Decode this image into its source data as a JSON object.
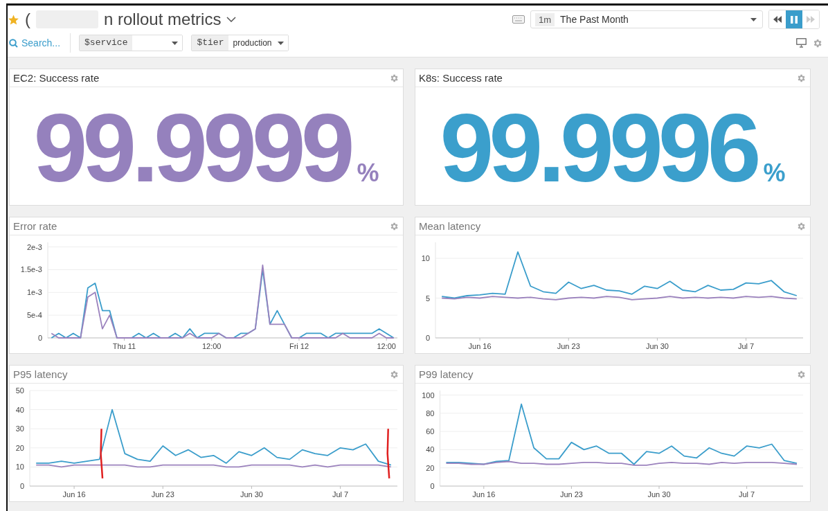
{
  "header": {
    "title_start": "(",
    "title_end": "n rollout metrics",
    "starred": true,
    "time": {
      "shortcut": "1m",
      "label": "The Past Month"
    },
    "playback": [
      {
        "kind": "rewind",
        "selected": false,
        "disabled": false
      },
      {
        "kind": "pause",
        "selected": true,
        "disabled": false
      },
      {
        "kind": "forward",
        "selected": false,
        "disabled": true
      }
    ],
    "search": {
      "label": "Search..."
    },
    "variables": [
      {
        "name": "$service"
      },
      {
        "name": "$tier",
        "value": "production"
      }
    ]
  },
  "widgets": [
    {
      "kind": "query_value",
      "title": "EC2: Success rate",
      "value": "99.9999",
      "unit": "%",
      "color": "#9581bd"
    },
    {
      "kind": "query_value",
      "title": "K8s: Success rate",
      "value": "99.9996",
      "unit": "%",
      "color": "#3b9fcc"
    },
    {
      "kind": "timeseries",
      "title": "Error rate",
      "chart_data": {
        "type": "line",
        "categories": [
          null,
          null,
          null,
          null,
          null,
          null,
          null,
          null,
          null,
          null,
          "Thu 11",
          null,
          null,
          null,
          null,
          null,
          null,
          null,
          null,
          null,
          null,
          null,
          "12:00",
          null,
          null,
          null,
          null,
          null,
          null,
          null,
          null,
          null,
          null,
          null,
          "Fri 12",
          null,
          null,
          null,
          null,
          null,
          null,
          null,
          null,
          null,
          null,
          null,
          "12:00",
          null
        ],
        "series": [
          {
            "color": "#3a9dcb",
            "values": [
              0,
              0.0001,
              0,
              0.0001,
              0,
              0.0011,
              0.0012,
              0.0006,
              0.0006,
              0,
              0,
              0,
              0.0001,
              0,
              0.0001,
              0,
              0,
              0.0001,
              0,
              0.0002,
              0,
              0.0001,
              0.0001,
              0.0001,
              0,
              0,
              0.0001,
              0.0001,
              0.0002,
              0.0015,
              0.0003,
              0.0006,
              0.0003,
              0,
              0,
              0.0001,
              0.0001,
              0.0001,
              0,
              0.0001,
              0.0001,
              0.0001,
              0.0001,
              0.0001,
              0.0001,
              0.0002,
              0.0001,
              0
            ]
          },
          {
            "color": "#9b82bd",
            "values": [
              0.0001,
              0,
              0,
              0,
              0,
              0.0009,
              0.001,
              0.0002,
              0.0005,
              0,
              0,
              0,
              0,
              0,
              0,
              0,
              0,
              0,
              0,
              0.0001,
              0,
              0,
              0,
              0.0001,
              0,
              0,
              0,
              0.0001,
              0.0002,
              0.0016,
              0.0003,
              0.0003,
              0.0003,
              0,
              0,
              0,
              0,
              0,
              0,
              0,
              0.0001,
              0,
              0,
              0,
              0,
              0.0001,
              0,
              0
            ]
          }
        ],
        "grid": true,
        "ylim": [
          0,
          0.0021
        ],
        "yticks": [
          {
            "value": 0,
            "label": "0"
          },
          {
            "value": 0.0005,
            "label": "5e-4"
          },
          {
            "value": 0.001,
            "label": "1e-3"
          },
          {
            "value": 0.0015,
            "label": "1.5e-3"
          },
          {
            "value": 0.002,
            "label": "2e-3"
          }
        ]
      }
    },
    {
      "kind": "timeseries",
      "title": "Mean latency",
      "chart_data": {
        "type": "line",
        "categories": [
          null,
          null,
          null,
          "Jun 16",
          null,
          null,
          null,
          null,
          null,
          null,
          "Jun 23",
          null,
          null,
          null,
          null,
          null,
          null,
          "Jun 30",
          null,
          null,
          null,
          null,
          null,
          null,
          "Jul 7",
          null,
          null,
          null,
          null
        ],
        "series": [
          {
            "color": "#3a9dcb",
            "values": [
              5.2,
              5.0,
              5.3,
              5.4,
              5.6,
              5.5,
              10.8,
              6.5,
              5.8,
              5.6,
              7.0,
              6.2,
              6.6,
              6.0,
              5.9,
              5.5,
              6.5,
              6.2,
              7.1,
              6.0,
              5.8,
              6.6,
              6.0,
              6.1,
              6.9,
              6.8,
              7.2,
              5.8,
              5.3
            ]
          },
          {
            "color": "#9b82bd",
            "values": [
              5.0,
              4.9,
              5.1,
              5.0,
              5.2,
              5.1,
              5.0,
              5.1,
              4.9,
              4.8,
              5.0,
              5.1,
              5.0,
              5.2,
              5.1,
              4.8,
              4.9,
              5.0,
              5.2,
              5.0,
              5.1,
              5.0,
              5.1,
              5.0,
              5.2,
              5.1,
              5.2,
              5.0,
              4.9
            ]
          }
        ],
        "grid": true,
        "ylim": [
          0,
          12
        ],
        "yticks": [
          0,
          5,
          10
        ]
      }
    },
    {
      "kind": "timeseries",
      "title": "P95 latency",
      "chart_data": {
        "type": "line",
        "categories": [
          null,
          null,
          null,
          "Jun 16",
          null,
          null,
          null,
          null,
          null,
          null,
          "Jun 23",
          null,
          null,
          null,
          null,
          null,
          null,
          "Jun 30",
          null,
          null,
          null,
          null,
          null,
          null,
          "Jul 7",
          null,
          null,
          null,
          null
        ],
        "series": [
          {
            "color": "#3a9dcb",
            "values": [
              12,
              12,
              13,
              12,
              13,
              14,
              40,
              17,
              14,
              13,
              21,
              16,
              19,
              15,
              16,
              12,
              18,
              16,
              20,
              15,
              14,
              19,
              17,
              16,
              20,
              19,
              22,
              13,
              11
            ]
          },
          {
            "color": "#9b82bd",
            "values": [
              11,
              11,
              10,
              11,
              11,
              11,
              11,
              11,
              10,
              10,
              11,
              11,
              11,
              11,
              11,
              10,
              10,
              11,
              11,
              11,
              11,
              10,
              11,
              10,
              11,
              11,
              11,
              11,
              10
            ]
          }
        ],
        "grid": true,
        "ylim": [
          0,
          50
        ],
        "yticks": [
          0,
          10,
          20,
          30,
          40,
          50
        ]
      },
      "pen_marks": [
        {
          "color": "#e02020"
        },
        {
          "color": "#e02020"
        }
      ]
    },
    {
      "kind": "timeseries",
      "title": "P99 latency",
      "chart_data": {
        "type": "line",
        "categories": [
          null,
          null,
          null,
          "Jun 16",
          null,
          null,
          null,
          null,
          null,
          null,
          "Jun 23",
          null,
          null,
          null,
          null,
          null,
          null,
          "Jun 30",
          null,
          null,
          null,
          null,
          null,
          null,
          "Jul 7",
          null,
          null,
          null,
          null
        ],
        "series": [
          {
            "color": "#3a9dcb",
            "values": [
              26,
              26,
              25,
              24,
              27,
              28,
              90,
              42,
              30,
              30,
              48,
              40,
              44,
              36,
              36,
              24,
              38,
              36,
              44,
              33,
              31,
              42,
              36,
              33,
              44,
              42,
              46,
              28,
              25
            ]
          },
          {
            "color": "#9b82bd",
            "values": [
              25,
              25,
              24,
              24,
              26,
              27,
              25,
              25,
              24,
              24,
              25,
              26,
              26,
              25,
              25,
              23,
              23,
              25,
              26,
              25,
              25,
              24,
              26,
              25,
              26,
              26,
              26,
              25,
              24
            ]
          }
        ],
        "grid": true,
        "ylim": [
          0,
          105
        ],
        "yticks": [
          0,
          20,
          40,
          60,
          80,
          100
        ]
      }
    }
  ]
}
